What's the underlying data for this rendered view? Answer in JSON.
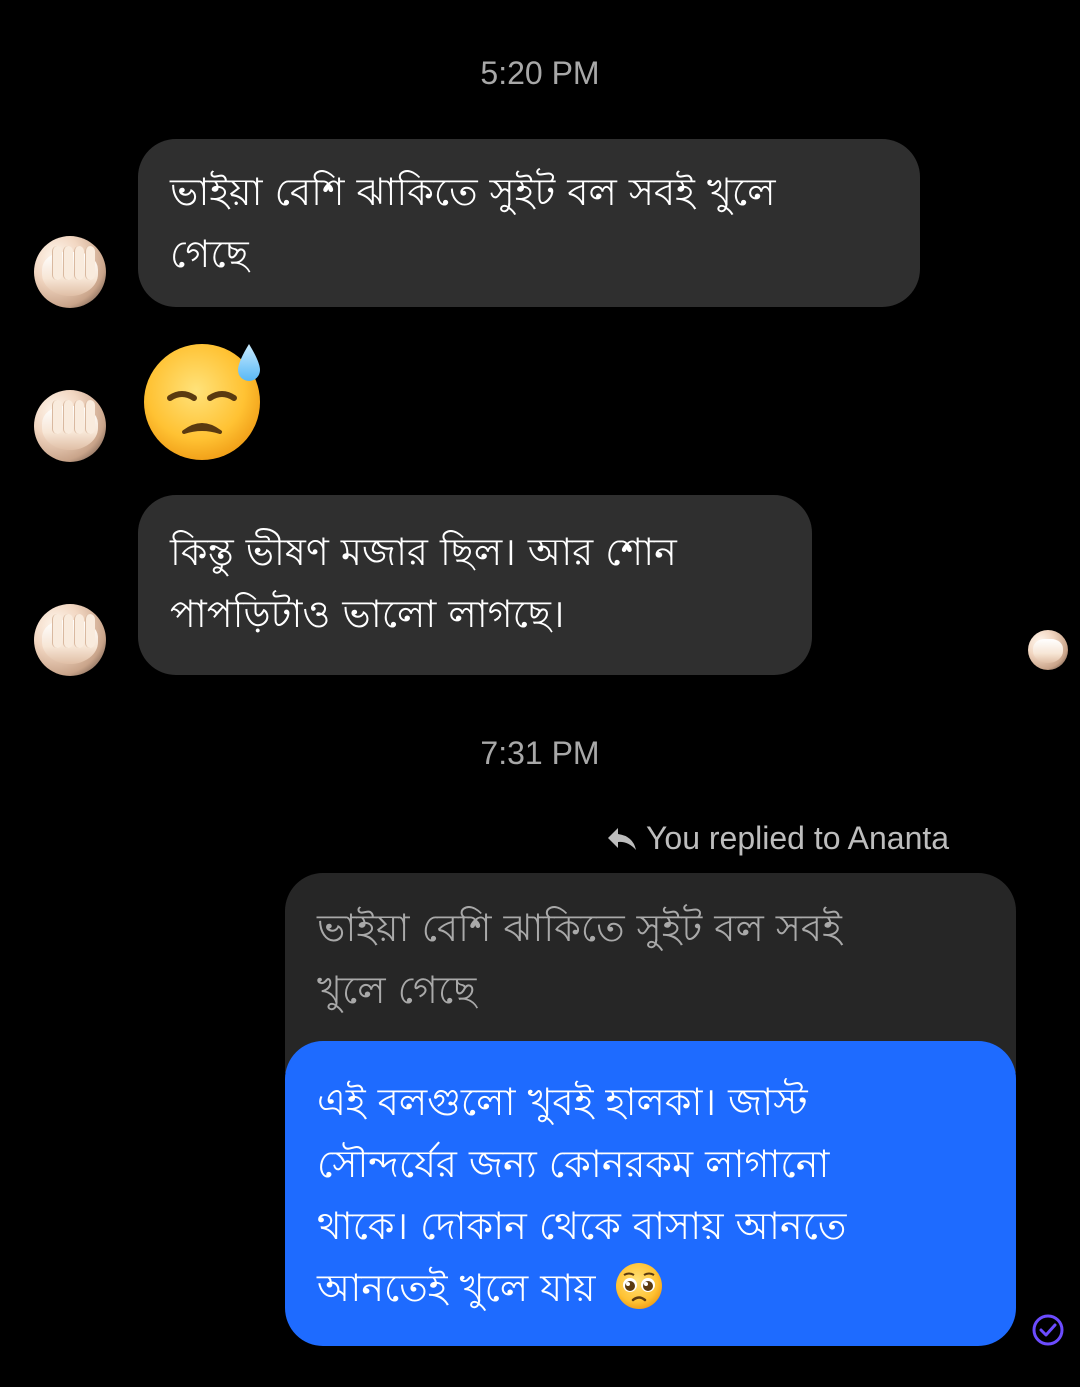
{
  "conversation": {
    "timestamps": [
      "5:20 PM",
      "7:31 PM"
    ],
    "received": [
      {
        "lines": [
          "ভাইয়া বেশি ঝাকিতে সুইট বল সবই খুলে",
          "গেছে"
        ]
      },
      {
        "emoji": "downcast-face-with-sweat"
      },
      {
        "lines": [
          "কিন্তু ভীষণ মজার ছিল। আর শোন",
          "পাপড়িটাও ভালো লাগছে।"
        ]
      }
    ],
    "reply": {
      "label": "You replied to Ananta",
      "quoted_lines": [
        "ভাইয়া বেশি ঝাকিতে সুইট বল সবই",
        "খুলে গেছে"
      ]
    },
    "sent": {
      "lines": [
        "এই বলগুলো খুবই হালকা। জাস্ট",
        "সৌন্দর্যের জন্য কোনরকম লাগানো",
        "থাকে।  দোকান থেকে বাসায় আনতে",
        "আনতেই খুলে যায়"
      ],
      "emoji": "pleading-face"
    },
    "status": "read-check-icon"
  },
  "colors": {
    "background": "#000000",
    "received_bubble": "#2f2f2f",
    "sent_bubble": "#1e6bff",
    "quoted_bubble": "#262626",
    "timestamp": "#a8a8a8",
    "status": "#6c4cff"
  }
}
